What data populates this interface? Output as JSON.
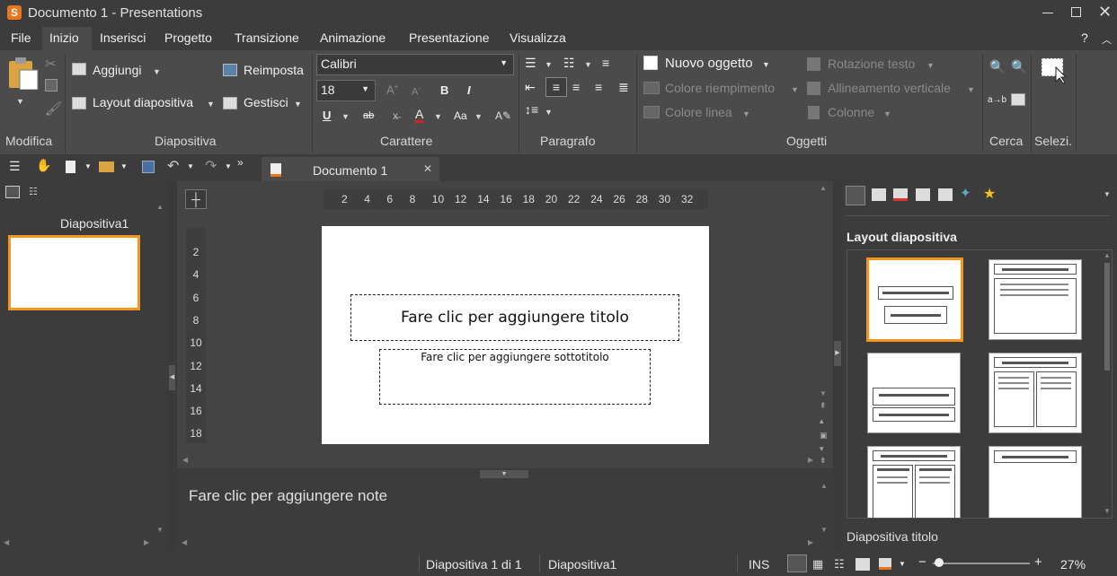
{
  "window": {
    "app_icon": "S",
    "title": "Documento 1 - Presentations",
    "controls": [
      "minimize",
      "maximize",
      "close"
    ]
  },
  "menu": {
    "items": [
      "File",
      "Inizio",
      "Inserisci",
      "Progetto",
      "Transizione",
      "Animazione",
      "Presentazione",
      "Visualizza"
    ],
    "active": "Inizio",
    "help": "?"
  },
  "ribbon": {
    "groups": {
      "modifica": "Modifica",
      "diapositiva": "Diapositiva",
      "carattere": "Carattere",
      "paragrafo": "Paragrafo",
      "oggetti": "Oggetti",
      "cerca": "Cerca",
      "selezione": "Selezi."
    },
    "aggiungi": "Aggiungi",
    "reimposta": "Reimposta",
    "layout_diapositiva": "Layout diapositiva",
    "gestisci": "Gestisci",
    "font_name": "Calibri",
    "font_size": "18",
    "nuovo_oggetto": "Nuovo oggetto",
    "colore_riempimento": "Colore riempimento",
    "colore_linea": "Colore linea",
    "rotazione_testo": "Rotazione testo",
    "allineamento_verticale": "Allineamento verticale",
    "colonne": "Colonne",
    "bold": "B",
    "italic": "I",
    "underline": "U",
    "strike": "ab",
    "font_color": "A"
  },
  "tab": {
    "label": "Documento 1"
  },
  "left_panel": {
    "slide_label": "Diapositiva1"
  },
  "ruler": {
    "h_ticks": [
      "2",
      "4",
      "6",
      "8",
      "10",
      "12",
      "14",
      "16",
      "18",
      "20",
      "22",
      "24",
      "26",
      "28",
      "30",
      "32"
    ],
    "v_ticks": [
      "2",
      "4",
      "6",
      "8",
      "10",
      "12",
      "14",
      "16",
      "18"
    ]
  },
  "slide": {
    "title_placeholder": "Fare clic per aggiungere titolo",
    "subtitle_placeholder": "Fare clic per aggiungere sottotitolo"
  },
  "notes": {
    "placeholder": "Fare clic per aggiungere note"
  },
  "right_panel": {
    "heading": "Layout diapositiva",
    "selected_layout": "Diapositiva titolo"
  },
  "status": {
    "slide_info": "Diapositiva 1 di 1",
    "slide_name": "Diapositiva1",
    "mode": "INS",
    "zoom": "27%"
  },
  "colors": {
    "accent": "#f7941d",
    "background": "#3c3c3c",
    "ribbon": "#4b4b4b"
  }
}
